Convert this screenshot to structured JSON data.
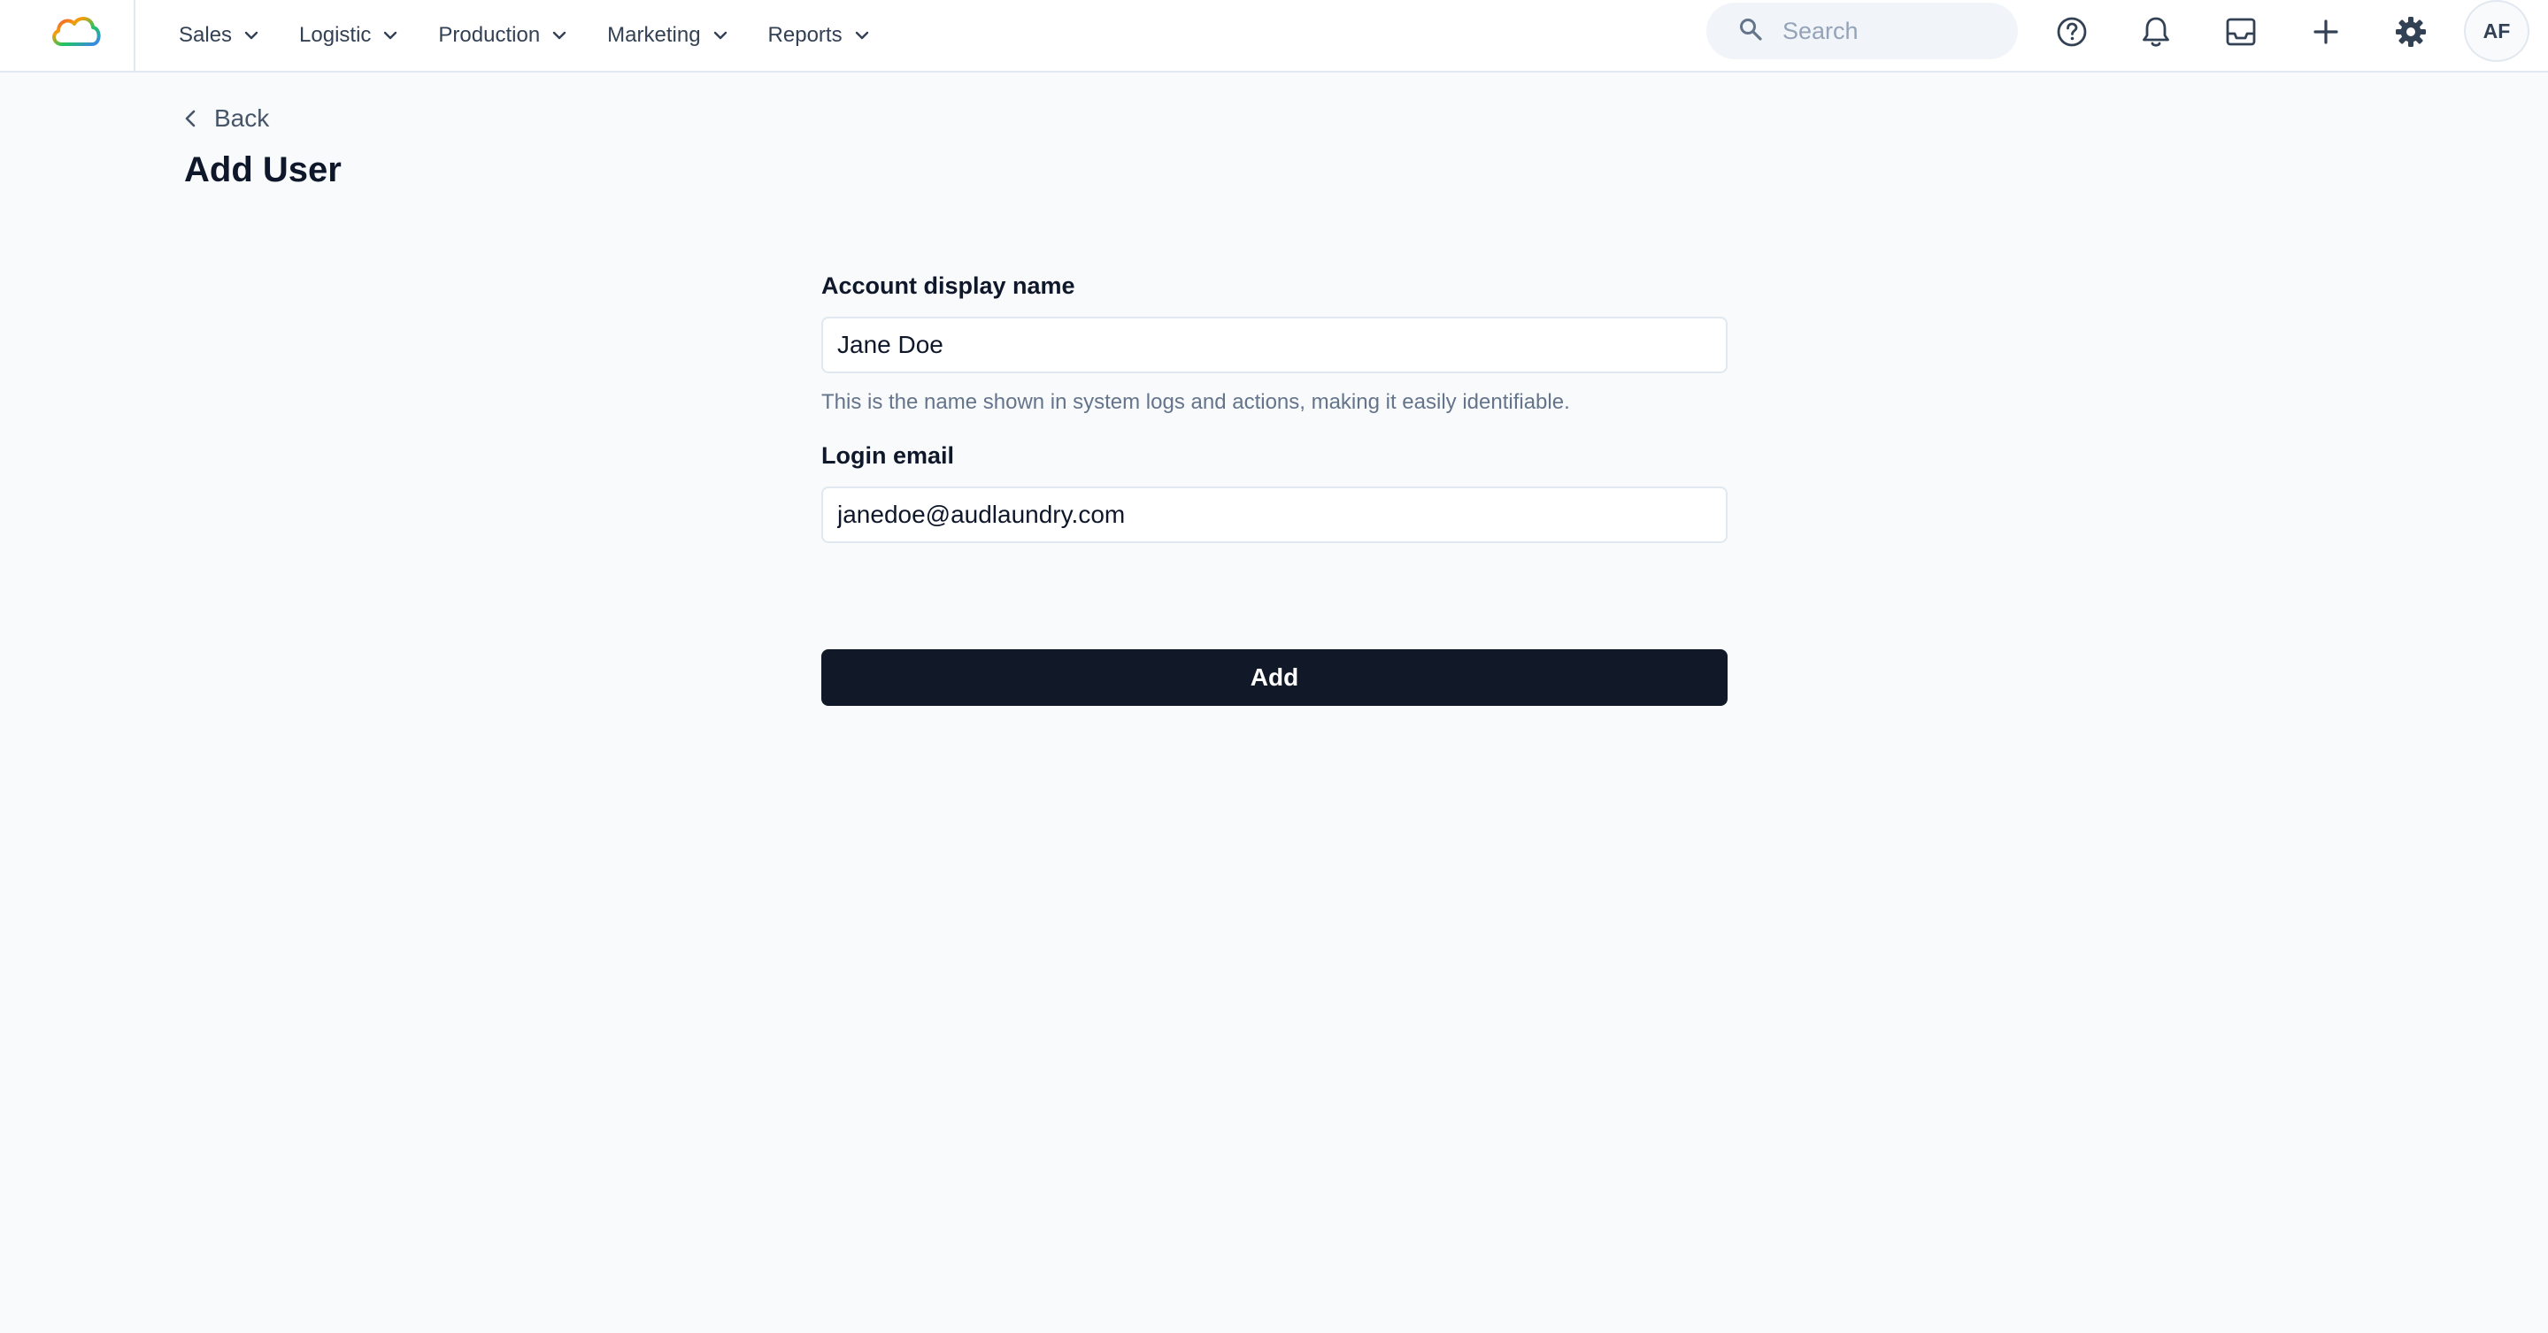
{
  "header": {
    "logo_icon": "cloud-logo-icon",
    "nav": [
      {
        "label": "Sales"
      },
      {
        "label": "Logistic"
      },
      {
        "label": "Production"
      },
      {
        "label": "Marketing"
      },
      {
        "label": "Reports"
      }
    ],
    "search": {
      "placeholder": "Search",
      "value": ""
    },
    "icons": [
      "help-icon",
      "bell-icon",
      "inbox-icon",
      "plus-icon",
      "gear-icon"
    ],
    "avatar_initials": "AF"
  },
  "page": {
    "back_label": "Back",
    "title": "Add User"
  },
  "form": {
    "display_name": {
      "label": "Account display name",
      "value": "Jane Doe",
      "help": "This is the name shown in system logs and actions, making it easily identifiable."
    },
    "email": {
      "label": "Login email",
      "value": "janedoe@audlaundry.com"
    },
    "submit_label": "Add"
  },
  "colors": {
    "background": "#f8fafc",
    "primary_button": "#111827",
    "border": "#e2e8f0",
    "muted_text": "#64748b"
  }
}
